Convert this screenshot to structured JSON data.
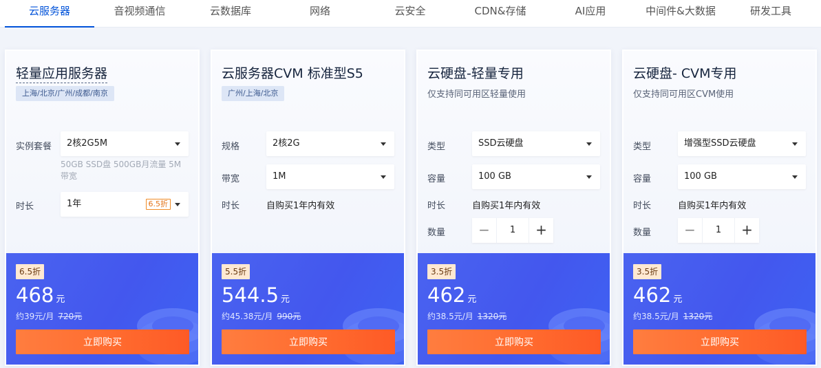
{
  "tabs": [
    {
      "label": "云服务器",
      "active": true
    },
    {
      "label": "音视频通信"
    },
    {
      "label": "云数据库"
    },
    {
      "label": "网络"
    },
    {
      "label": "云安全"
    },
    {
      "label": "CDN&存储"
    },
    {
      "label": "AI应用"
    },
    {
      "label": "中间件&大数据"
    },
    {
      "label": "研发工具"
    }
  ],
  "colors": {
    "accent": "#0052d9",
    "panel": "#4a63f0",
    "buy": "#ff6a2e"
  },
  "cards": [
    {
      "title": "轻量应用服务器",
      "region": "上海/北京/广州/成都/南京",
      "instance_label": "实例套餐",
      "instance_value": "2核2G5M",
      "spec_note": "50GB SSD盘 500GB月流量 5M带宽",
      "duration_label": "时长",
      "duration_value": "1年",
      "duration_discount": "6.5折",
      "discount": "6.5折",
      "price": "468",
      "unit": "元",
      "monthly": "约39元/月",
      "original": "720元",
      "buy": "立即购买"
    },
    {
      "title": "云服务器CVM 标准型S5",
      "region": "广州/上海/北京",
      "spec_label": "规格",
      "spec_value": "2核2G",
      "bandwidth_label": "带宽",
      "bandwidth_value": "1M",
      "duration_label": "时长",
      "duration_value": "自购买1年内有效",
      "discount": "5.5折",
      "price": "544.5",
      "unit": "元",
      "monthly": "约45.38元/月",
      "original": "990元",
      "buy": "立即购买"
    },
    {
      "title": "云硬盘-轻量专用",
      "subtitle": "仅支持同可用区轻量使用",
      "type_label": "类型",
      "type_value": "SSD云硬盘",
      "capacity_label": "容量",
      "capacity_value": "100 GB",
      "duration_label": "时长",
      "duration_value": "自购买1年内有效",
      "qty_label": "数量",
      "qty_value": "1",
      "discount": "3.5折",
      "price": "462",
      "unit": "元",
      "monthly": "约38.5元/月",
      "original": "1320元",
      "buy": "立即购买"
    },
    {
      "title": "云硬盘- CVM专用",
      "subtitle": "仅支持同可用区CVM使用",
      "type_label": "类型",
      "type_value": "增强型SSD云硬盘",
      "capacity_label": "容量",
      "capacity_value": "100 GB",
      "duration_label": "时长",
      "duration_value": "自购买1年内有效",
      "qty_label": "数量",
      "qty_value": "1",
      "discount": "3.5折",
      "price": "462",
      "unit": "元",
      "monthly": "约38.5元/月",
      "original": "1320元",
      "buy": "立即购买"
    }
  ],
  "stepper": {
    "minus": "−",
    "plus": "+"
  }
}
